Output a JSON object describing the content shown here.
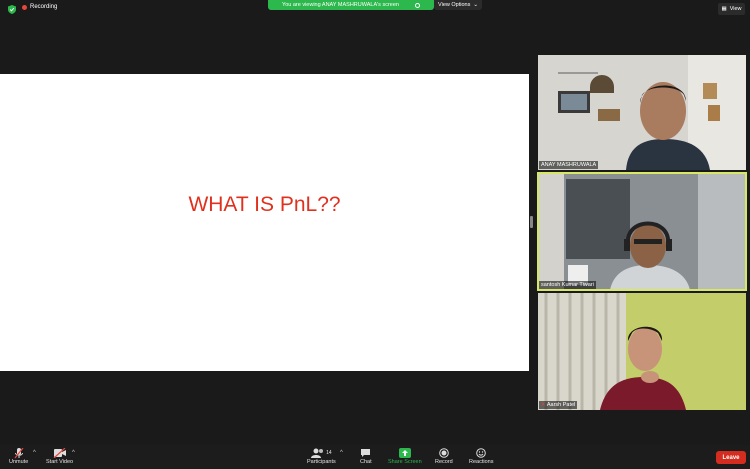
{
  "top": {
    "recording_label": "Recording",
    "viewing_text": "You are viewing ANAY MASHRUWALA's screen",
    "view_options_label": "View Options",
    "view_label": "View"
  },
  "slide": {
    "title": "WHAT IS PnL??"
  },
  "participants": [
    {
      "name": "ANAY MASHRUWALA"
    },
    {
      "name": "santosh Kumar Tiwari"
    },
    {
      "name": "Aarsh Patel"
    }
  ],
  "toolbar": {
    "unmute": "Unmute",
    "start_video": "Start Video",
    "participants_label": "Participants",
    "participants_count": "14",
    "chat": "Chat",
    "share_screen": "Share Screen",
    "record": "Record",
    "reactions": "Reactions",
    "leave": "Leave"
  },
  "colors": {
    "share_green": "#2db84d",
    "leave_red": "#d42d20",
    "active_speaker": "#d9e766",
    "slide_text": "#e0311f"
  }
}
